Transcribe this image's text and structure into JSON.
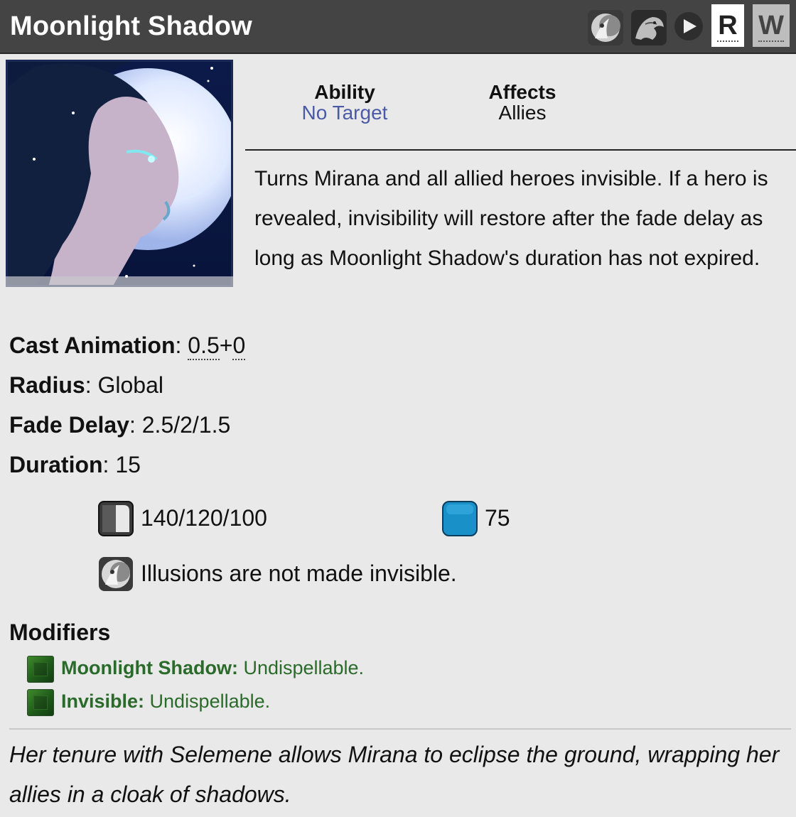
{
  "header": {
    "title": "Moonlight Shadow",
    "icons": [
      "mirana-icon",
      "sagan-icon",
      "play-icon"
    ],
    "key_r": "R",
    "key_w": "W"
  },
  "info": {
    "ability_label": "Ability",
    "ability_value": "No Target",
    "affects_label": "Affects",
    "affects_value": "Allies"
  },
  "description": "Turns Mirana and all allied heroes invisible. If a hero is revealed, invisibility will restore after the fade delay as long as Moonlight Shadow's duration has not expired.",
  "stats": {
    "cast_label": "Cast Animation",
    "cast_value_a": "0.5",
    "cast_plus": "+",
    "cast_value_b": "0",
    "radius_label": "Radius",
    "radius_value": "Global",
    "fade_label": "Fade Delay",
    "fade_value": "2.5/2/1.5",
    "duration_label": "Duration",
    "duration_value": "15",
    "colon": ":"
  },
  "costs": {
    "cooldown": "140/120/100",
    "mana": "75"
  },
  "note": "Illusions are not made invisible.",
  "modifiers": {
    "title": "Modifiers",
    "items": [
      {
        "name": "Moonlight Shadow:",
        "desc": " Undispellable."
      },
      {
        "name": "Invisible:",
        "desc": " Undispellable."
      }
    ]
  },
  "lore": "Her tenure with Selemene allows Mirana to eclipse the ground, wrapping her allies in a cloak of shadows.",
  "colors": {
    "header_bg": "#444444",
    "page_bg": "#e9e9e9",
    "link_blue": "#4a5aa8",
    "modifier_green": "#2a6a2a",
    "mana_blue": "#1a90c8"
  }
}
